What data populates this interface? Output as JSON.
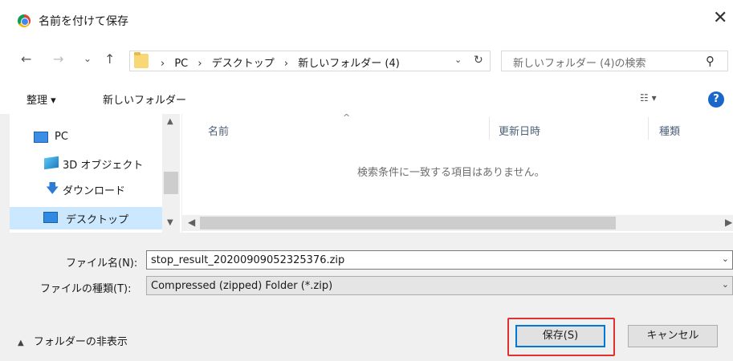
{
  "window": {
    "title": "名前を付けて保存",
    "close_glyph": "✕"
  },
  "nav": {
    "back_glyph": "←",
    "forward_glyph": "→",
    "recent_glyph": "⌄",
    "up_glyph": "↑",
    "breadcrumbs": [
      "PC",
      "デスクトップ",
      "新しいフォルダー (4)"
    ],
    "crumb_sep": "›",
    "search_placeholder": "新しいフォルダー (4)の検索",
    "search_glyph": "⚲",
    "refresh_glyph": "↻",
    "dropdown_glyph": "⌄"
  },
  "toolbar": {
    "organize": "整理 ▾",
    "new_folder": "新しいフォルダー",
    "view": "☷ ▾",
    "help": "?"
  },
  "sidebar": {
    "items": [
      {
        "label": "PC"
      },
      {
        "label": "3D オブジェクト"
      },
      {
        "label": "ダウンロード"
      },
      {
        "label": "デスクトップ"
      }
    ]
  },
  "file_list": {
    "columns": [
      "名前",
      "更新日時",
      "種類"
    ],
    "sort_glyph": "^",
    "empty_message": "検索条件に一致する項目はありません。"
  },
  "form": {
    "filename_label": "ファイル名(N):",
    "filename_value": "stop_result_20200909052325376.zip",
    "filetype_label": "ファイルの種類(T):",
    "filetype_value": "Compressed (zipped) Folder (*.zip)"
  },
  "footer": {
    "hide_folders": "フォルダーの非表示",
    "save_button": "保存(S)",
    "cancel_button": "キャンセル"
  },
  "colors": {
    "highlight": "#e03030",
    "accent": "#0078d7"
  }
}
